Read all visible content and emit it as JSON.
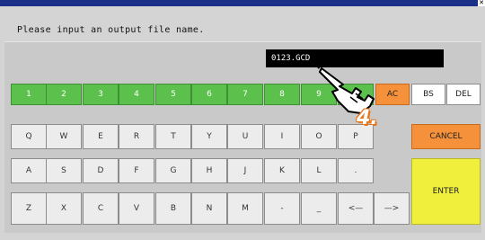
{
  "prompt": "Please input an output file name.",
  "filename_value": "0123.GCD",
  "step_label": "4.",
  "close_label": "✕",
  "keys": {
    "row1": [
      "1",
      "2",
      "3",
      "4",
      "5",
      "6",
      "7",
      "8",
      "9"
    ],
    "row2": [
      "Q",
      "W",
      "E",
      "R",
      "T",
      "Y",
      "U",
      "I",
      "O",
      "P"
    ],
    "row3": [
      "A",
      "S",
      "D",
      "F",
      "G",
      "H",
      "J",
      "K",
      "L",
      "."
    ],
    "row4": [
      "Z",
      "X",
      "C",
      "V",
      "B",
      "N",
      "M",
      "-",
      "_",
      "<—",
      "—>"
    ],
    "ac": "AC",
    "bs": "BS",
    "del": "DEL",
    "cancel": "CANCEL",
    "enter": "ENTER"
  },
  "colors": {
    "digit_key": "#5cc04c",
    "function_key": "#f5913a",
    "enter_key": "#efef3c",
    "title_bar": "#1a2f88"
  },
  "icons": {
    "pointer": "hand-pointer-icon"
  }
}
